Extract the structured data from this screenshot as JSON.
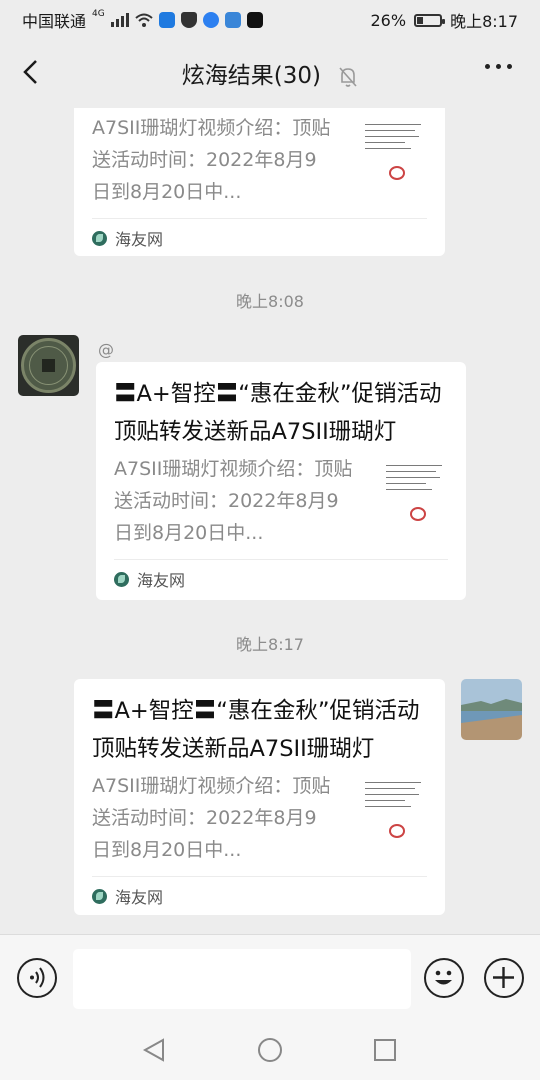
{
  "status_bar": {
    "carrier": "中国联通",
    "network": "4G",
    "battery": "26%",
    "battery_level": 0.26,
    "time": "晚上8:17"
  },
  "header": {
    "title": "炫海结果(30)",
    "back_icon": "chevron-left-icon",
    "mute_icon": "bell-off-icon",
    "more_icon": "more-dots-icon"
  },
  "messages": [
    {
      "sender": "",
      "title": "",
      "desc": "A7SII珊瑚灯视频介绍：顶贴送活动时间：2022年8月9日到8月20日中...",
      "source": "海友网"
    },
    {
      "timestamp": "晚上8:08",
      "sender_prefix": "@",
      "title": "〓A+智控〓“惠在金秋”促销活动顶贴转发送新品A7SII珊瑚灯",
      "desc": "A7SII珊瑚灯视频介绍：顶贴送活动时间：2022年8月9日到8月20日中...",
      "source": "海友网"
    },
    {
      "timestamp": "晚上8:17",
      "title": "〓A+智控〓“惠在金秋”促销活动顶贴转发送新品A7SII珊瑚灯",
      "desc": "A7SII珊瑚灯视频介绍：顶贴送活动时间：2022年8月9日到8月20日中...",
      "source": "海友网"
    }
  ],
  "input_bar": {
    "voice_icon": "voice-icon",
    "emoji_icon": "emoji-icon",
    "add_icon": "plus-circle-icon",
    "placeholder": ""
  },
  "nav": {
    "back": "triangle-back-icon",
    "home": "circle-home-icon",
    "recents": "square-recents-icon"
  }
}
